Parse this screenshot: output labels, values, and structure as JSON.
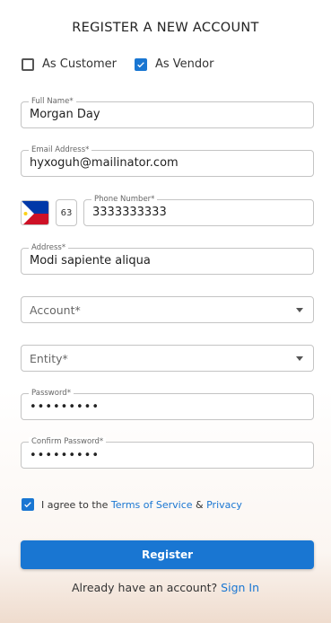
{
  "form": {
    "title": "REGISTER A NEW ACCOUNT",
    "roles": [
      {
        "label": "As Customer",
        "checked": false
      },
      {
        "label": "As Vendor",
        "checked": true
      }
    ],
    "full_name": {
      "label": "Full Name*",
      "value": "Morgan Day"
    },
    "email": {
      "label": "Email Address*",
      "value": "hyxoguh@mailinator.com"
    },
    "phone": {
      "country_code": "63",
      "label": "Phone Number*",
      "value": "3333333333",
      "flag_icon": "philippines-flag-icon"
    },
    "address": {
      "label": "Address*",
      "value": "Modi sapiente aliqua"
    },
    "account": {
      "placeholder": "Account*"
    },
    "entity": {
      "placeholder": "Entity*"
    },
    "password": {
      "label": "Password*",
      "masked_value": "•••••••••"
    },
    "confirm_password": {
      "label": "Confirm Password*",
      "masked_value": "•••••••••"
    },
    "agree": {
      "checked": true,
      "prefix": "I agree to the",
      "terms_link": "Terms of Service",
      "and": "&",
      "privacy_link": "Privacy"
    },
    "register_label": "Register",
    "signin_prompt": "Already have an account?",
    "signin_link": "Sign In"
  },
  "colors": {
    "accent": "#1976d2",
    "border": "#c4c4c4"
  }
}
